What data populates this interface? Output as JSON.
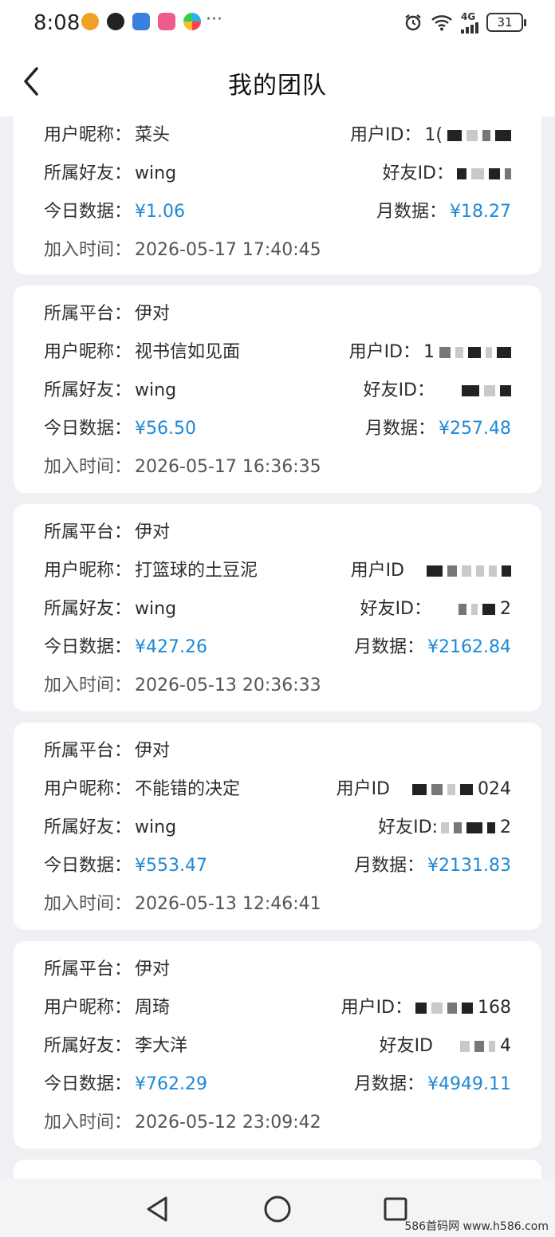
{
  "status_bar": {
    "time": "8:08",
    "more": "···",
    "network": "4G",
    "battery": "31"
  },
  "header": {
    "title": "我的团队"
  },
  "cards": [
    {
      "platform": null,
      "nickname": "菜头",
      "friend": "wing",
      "today": "¥1.06",
      "month": "¥18.27",
      "joined": "2026-05-17 17:40:45",
      "uid_label": "用户ID：",
      "uid_visible": "1(",
      "fid_label": "好友ID：",
      "fid_visible": ""
    },
    {
      "platform": "伊对",
      "nickname": "视书信如见面",
      "friend": "wing",
      "today": "¥56.50",
      "month": "¥257.48",
      "joined": "2026-05-17 16:36:35",
      "uid_label": "用户ID：",
      "uid_visible": "1",
      "fid_label": "好友ID：",
      "fid_visible": ""
    },
    {
      "platform": "伊对",
      "nickname": "打篮球的土豆泥",
      "friend": "wing",
      "today": "¥427.26",
      "month": "¥2162.84",
      "joined": "2026-05-13 20:36:33",
      "uid_label": "用户ID",
      "uid_visible": "",
      "fid_label": "好友ID：",
      "fid_visible": "2"
    },
    {
      "platform": "伊对",
      "nickname": "不能错的决定",
      "friend": "wing",
      "today": "¥553.47",
      "month": "¥2131.83",
      "joined": "2026-05-13 12:46:41",
      "uid_label": "用户ID",
      "uid_visible": "024",
      "fid_label": "好友ID:",
      "fid_visible": "2"
    },
    {
      "platform": "伊对",
      "nickname": "周琦",
      "friend": "李大洋",
      "today": "¥762.29",
      "month": "¥4949.11",
      "joined": "2026-05-12 23:09:42",
      "uid_label": "用户ID：",
      "uid_visible": "168",
      "fid_label": "好友ID",
      "fid_visible": "4"
    }
  ],
  "labels": {
    "platform": "所属平台：",
    "nickname": "用户昵称：",
    "friend": "所属好友：",
    "today": "今日数据：",
    "month": "月数据：",
    "joined": "加入时间："
  },
  "watermark": "586首码网 www.h586.com"
}
